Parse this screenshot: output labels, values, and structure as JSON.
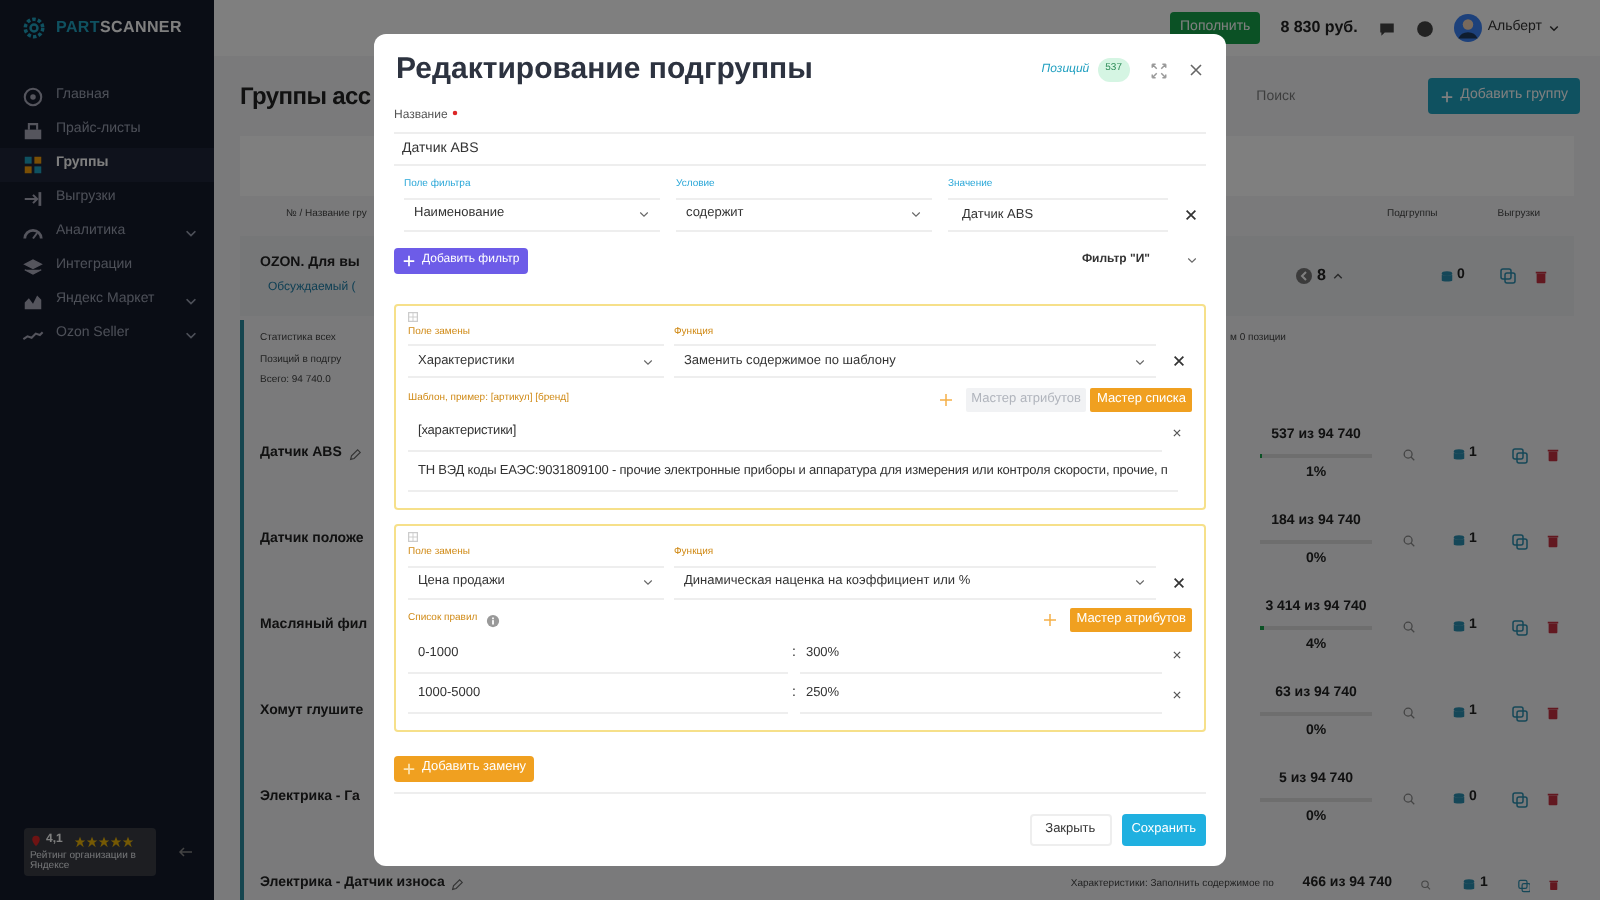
{
  "sidebar": {
    "logo": [
      "PART",
      "SCANNER"
    ],
    "items": [
      {
        "label": "Главная",
        "selected": false,
        "expandable": false
      },
      {
        "label": "Прайс-листы",
        "selected": false,
        "expandable": false
      },
      {
        "label": "Группы",
        "selected": true,
        "expandable": false
      },
      {
        "label": "Выгрузки",
        "selected": false,
        "expandable": false
      },
      {
        "label": "Аналитика",
        "selected": false,
        "expandable": true
      },
      {
        "label": "Интеграции",
        "selected": false,
        "expandable": false
      },
      {
        "label": "Яндекс Маркет",
        "selected": false,
        "expandable": true
      },
      {
        "label": "Ozon Seller",
        "selected": false,
        "expandable": true
      }
    ],
    "rating": {
      "score": "4,1",
      "stars": 5,
      "caption": "Рейтинг организации в Яндексе"
    }
  },
  "header": {
    "top_up_button": "Пополнить",
    "balance": "8 830 руб.",
    "user": "Альберт"
  },
  "page": {
    "title": "Группы асс",
    "search": {
      "placeholder": "Поиск"
    },
    "add_group_button": "Добавить группу",
    "columns": [
      "№ / Название гру",
      "Подгруппы",
      "Выгрузки"
    ],
    "group": {
      "name": "OZON. Для вы",
      "link": "Обсуждаемый (",
      "subgroups": "8",
      "exports": "0"
    },
    "stats": [
      "Статистика всех",
      "Позиций в подгру",
      "Всего: 94 740.0"
    ],
    "stats_note": "м 0 позиции",
    "rows": [
      {
        "name": "Датчик ABS",
        "edit_icon": true,
        "count": "537 из 94 740",
        "level": 0.01,
        "percent": "1%",
        "exports": "1"
      },
      {
        "name": "Датчик положе",
        "edit_icon": false,
        "count": "184 из 94 740",
        "level": 0,
        "percent": "0%",
        "exports": "1"
      },
      {
        "name": "Масляный фил",
        "edit_icon": false,
        "count": "3 414 из 94 740",
        "level": 0.04,
        "percent": "4%",
        "exports": "1"
      },
      {
        "name": "Хомут глушите",
        "edit_icon": false,
        "count": "63 из 94 740",
        "level": 0,
        "percent": "0%",
        "exports": "1"
      },
      {
        "name": "Электрика - Га",
        "edit_icon": false,
        "count": "5 из 94 740",
        "level": 0,
        "percent": "0%",
        "exports": "0"
      },
      {
        "name": "Электрика - Датчик износа",
        "edit_icon": true,
        "count": "466 из 94 740",
        "exports": "1",
        "note": "Характеристики: Заполнить содержимое по"
      }
    ]
  },
  "modal": {
    "title": "Редактирование подгруппы",
    "positions_label": "Позиций",
    "positions_count": "537",
    "name_field": {
      "label": "Название",
      "required": true,
      "value": "Датчик ABS"
    },
    "filter_labels": [
      "Поле фильтра",
      "Условие",
      "Значение"
    ],
    "filters": [
      {
        "field": "Наименование",
        "condition": "содержит",
        "value": "Датчик ABS"
      }
    ],
    "add_filter_button": "Добавить фильтр",
    "filter_mode": "Фильтр \"И\"",
    "replacements": [
      {
        "field_label": "Поле замены",
        "function_label": "Функция",
        "field": "Характеристики",
        "function": "Заменить содержимое по шаблону",
        "list_label": "Шаблон, пример: [артикул] [бренд]",
        "info_icon": false,
        "buttons": [
          {
            "label": "Мастер атрибутов",
            "disabled": true
          },
          {
            "label": "Мастер списка",
            "disabled": false
          }
        ],
        "entries": [
          {
            "kind": "text",
            "value": "[характеристики]"
          },
          {
            "kind": "text",
            "value": "ТН ВЭД коды ЕАЭС:9031809100 - прочие электронные приборы и аппаратура для измерения или контроля скорости, прочие, п"
          }
        ]
      },
      {
        "field_label": "Поле замены",
        "function_label": "Функция",
        "field": "Цена продажи",
        "function": "Динамическая наценка на коэффициент или %",
        "list_label": "Список правил",
        "info_icon": true,
        "buttons": [
          {
            "label": "Мастер атрибутов",
            "disabled": false
          }
        ],
        "entries": [
          {
            "kind": "rule",
            "key": "0-1000",
            "separator": ":",
            "value": "300%"
          },
          {
            "kind": "rule",
            "key": "1000-5000",
            "separator": ":",
            "value": "250%"
          }
        ]
      }
    ],
    "add_replacement_button": "Добавить замену",
    "close_button": "Закрыть",
    "save_button": "Сохранить"
  }
}
